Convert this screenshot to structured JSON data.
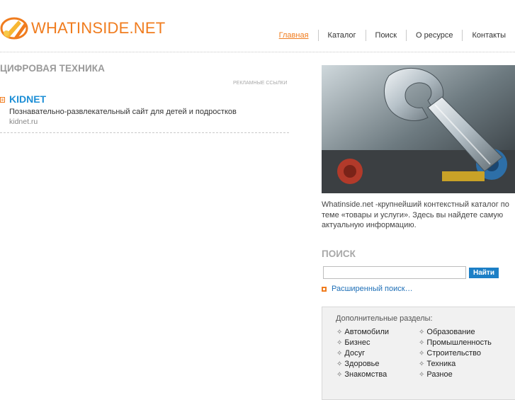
{
  "site": {
    "name": "WHATINSIDE.NET"
  },
  "nav": [
    {
      "label": "Главная",
      "active": true
    },
    {
      "label": "Каталог",
      "active": false
    },
    {
      "label": "Поиск",
      "active": false
    },
    {
      "label": "О ресурсе",
      "active": false
    },
    {
      "label": "Контакты",
      "active": false
    }
  ],
  "main": {
    "section_title": "ЦИФРОВАЯ ТЕХНИКА",
    "ads_label": "РЕКЛАМНЫЕ ССЫЛКИ",
    "ad": {
      "title": "KIDNET",
      "description": "Познавательно-развлекательный сайт для детей и подростков",
      "url": "kidnet.ru"
    }
  },
  "sidebar": {
    "about": "Whatinside.net  -крупнейший контекстный каталог по теме «товары и услуги». Здесь вы найдете самую актуальную информацию.",
    "search": {
      "title": "ПОИСК",
      "input_value": "",
      "button_label": "Найти",
      "advanced_link": "Расширенный поиск…"
    },
    "extra": {
      "title": "Дополнительные разделы:",
      "items": [
        "Автомобили",
        "Образование",
        "Бизнес",
        "Промышленность",
        "Досуг",
        "Строительство",
        "Здоровье",
        "Техника",
        "Знакомства",
        "Разное"
      ]
    }
  },
  "colors": {
    "accent": "#f07c1e",
    "link": "#1e8fd6",
    "button": "#1c7fc6"
  }
}
